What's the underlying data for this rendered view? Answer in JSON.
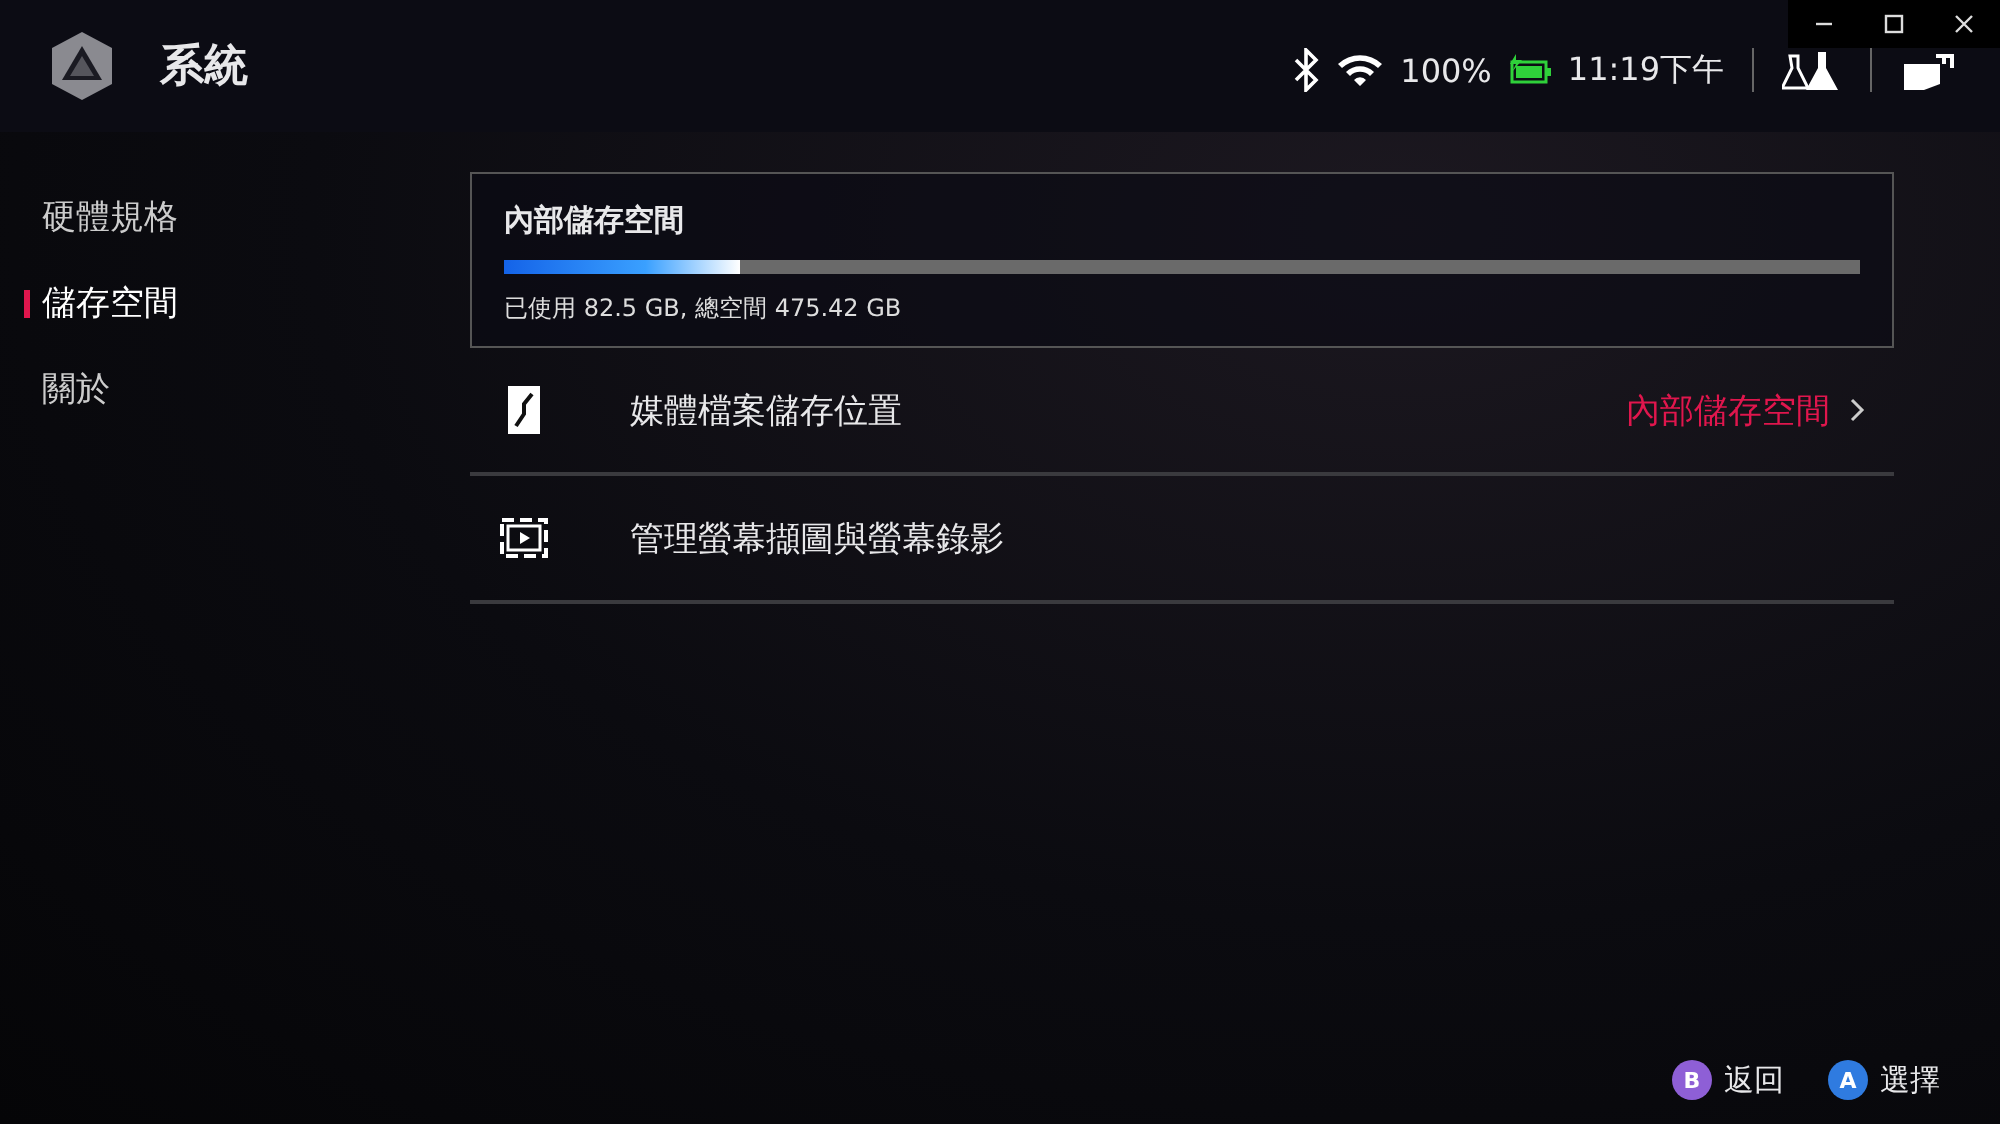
{
  "header": {
    "title": "系統"
  },
  "status": {
    "battery": "100%",
    "time": "11:19下午"
  },
  "sidebar": {
    "items": [
      {
        "label": "硬體規格",
        "selected": false
      },
      {
        "label": "儲存空間",
        "selected": true
      },
      {
        "label": "關於",
        "selected": false
      }
    ]
  },
  "storage": {
    "title": "內部儲存空間",
    "level": 0.174,
    "usage": "已使用 82.5 GB, 總空間 475.42 GB"
  },
  "settings": [
    {
      "kind": "media",
      "label": "媒體檔案儲存位置",
      "value": "內部儲存空間"
    },
    {
      "kind": "capture",
      "label": "管理螢幕擷圖與螢幕錄影"
    }
  ],
  "footer": [
    {
      "key": "B",
      "label": "返回",
      "color": "#8e5fd6"
    },
    {
      "key": "A",
      "label": "選擇",
      "color": "#2f7be0"
    }
  ]
}
